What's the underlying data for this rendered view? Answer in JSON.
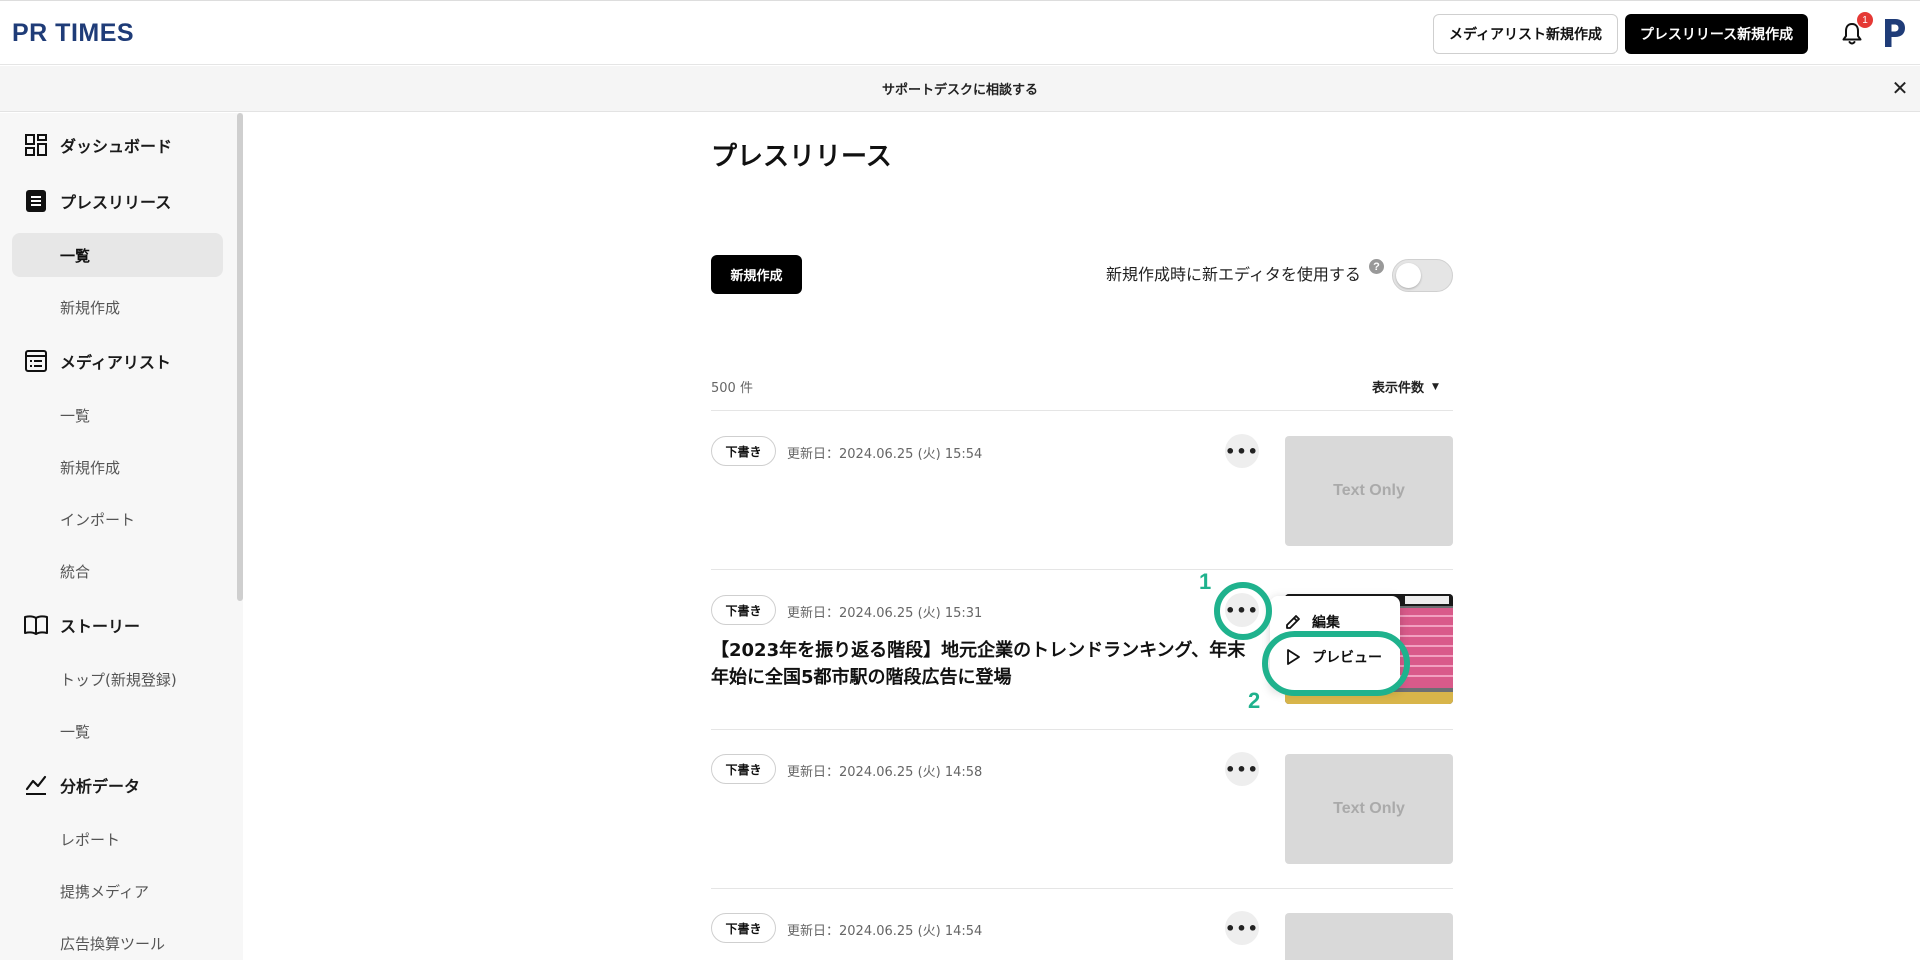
{
  "header": {
    "logo": "PR TIMES",
    "media_list_new_label": "メディアリスト新規作成",
    "press_release_new_label": "プレスリリース新規作成",
    "notification_count": "1"
  },
  "support_bar": {
    "label": "サポートデスクに相談する"
  },
  "sidebar": {
    "dashboard": "ダッシュボード",
    "press_release": "プレスリリース",
    "pr_list": "一覧",
    "pr_new": "新規作成",
    "media_list": "メディアリスト",
    "ml_list": "一覧",
    "ml_new": "新規作成",
    "ml_import": "インポート",
    "ml_merge": "統合",
    "story": "ストーリー",
    "story_top": "トップ(新規登録)",
    "story_list": "一覧",
    "analytics": "分析データ",
    "report": "レポート",
    "partner_media": "提携メディア",
    "ad_calc": "広告換算ツール"
  },
  "main": {
    "title": "プレスリリース",
    "new_button": "新規作成",
    "editor_toggle_label": "新規作成時に新エディタを使用する",
    "help": "?",
    "count": "500 件",
    "per_page_label": "表示件数",
    "rows": [
      {
        "status": "下書き",
        "updated": "更新日：2024.06.25 (火) 15:54",
        "thumb": "Text Only"
      },
      {
        "status": "下書き",
        "updated": "更新日：2024.06.25 (火) 15:31",
        "title": "【2023年を振り返る階段】地元企業のトレンドランキング、年末年始に全国5都市駅の階段広告に登場"
      },
      {
        "status": "下書き",
        "updated": "更新日：2024.06.25 (火) 14:58",
        "thumb": "Text Only"
      },
      {
        "status": "下書き",
        "updated": "更新日：2024.06.25 (火) 14:54"
      }
    ],
    "more_icon": "•••"
  },
  "context_menu": {
    "edit": "編集",
    "preview": "プレビュー"
  },
  "annotations": {
    "step1": "1",
    "step2": "2",
    "color": "#1fb28d"
  },
  "colors": {
    "logo": "#1f3c78",
    "badge": "#e53935",
    "primary_button": "#000000"
  }
}
